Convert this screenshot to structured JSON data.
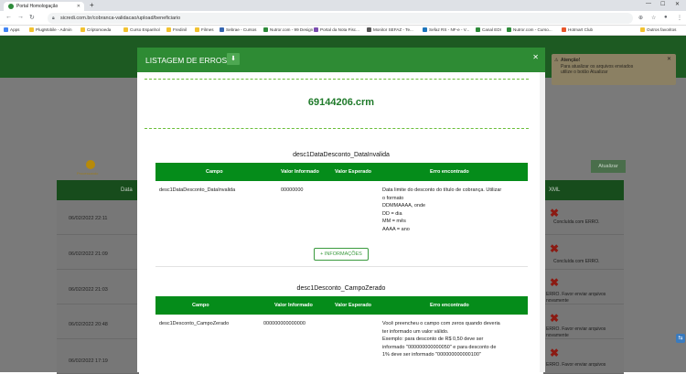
{
  "browser": {
    "tab_title": "Portal Homologação",
    "address": "sicredi.com.br/cobranca-validacao/upload/beneficiario",
    "bookmarks": [
      "Apps",
      "PlugMobile - Admin",
      "Criptomoeda",
      "Curso Espanhol",
      "Fredinil",
      "Filmes",
      "Sebrae - Cursos",
      "Nutror.com - 99 Design",
      "Portal da Nota Fisc...",
      "Monitor SEFAZ - Te...",
      "Sefaz RS - NF-e - V...",
      "Canal EDI",
      "Nutror.com - Curso...",
      "Hotmart Club",
      "Outros favoritos"
    ]
  },
  "background": {
    "dot_label": "Processando",
    "atualizar_label": "Atualizar",
    "columns": {
      "data": "Data",
      "xml": "XML"
    },
    "rows": [
      {
        "date": "06/02/2022 22:11",
        "status": "Concluída com ERRO."
      },
      {
        "date": "06/02/2022 21:09",
        "status": "Concluída com ERRO."
      },
      {
        "date": "06/02/2022 21:03",
        "status": "ERRO. Favor enviar arquivos novamente"
      },
      {
        "date": "06/02/2022 20:48",
        "status": "ERRO. Favor enviar arquivos novamente"
      },
      {
        "date": "06/02/2022 17:19",
        "status": "ERRO. Favor enviar arquivos"
      }
    ],
    "toast": {
      "title": "Atenção!",
      "line1": "Para atualizar os arquivos enviados",
      "line2": "utilize o botão Atualizar"
    }
  },
  "modal": {
    "title": "LISTAGEM DE ERROS",
    "filename": "69144206.crm",
    "headers": {
      "campo": "Campo",
      "valor_informado": "Valor Informado",
      "valor_esperado": "Valor Esperado",
      "erro": "Erro encontrado"
    },
    "info_button": "+ INFORMAÇÕES",
    "sections": [
      {
        "title": "desc1DataDesconto_DataInvalida",
        "campo": "desc1DataDesconto_DataInvalida",
        "valor_informado": "00000000",
        "valor_esperado": "",
        "erro_lines": [
          "Data limite do desconto do título de cobrança. Utilizar",
          "o formato",
          "DDMMAAAA, onde",
          "DD = dia",
          "MM = mês",
          "AAAA = ano"
        ]
      },
      {
        "title": "desc1Desconto_CampoZerado",
        "campo": "desc1Desconto_CampoZerado",
        "valor_informado": "000000000000000",
        "valor_esperado": "",
        "erro_lines": [
          "Você preencheu o campo com zeros quando deveria",
          "ter informado um valor válido.",
          "Exemplo: para desconto de R$ 0,50 deve ser",
          "informado \"000000000000050\" e para desconto de",
          "1% deve ser informado \"000000000000100\""
        ]
      }
    ]
  }
}
